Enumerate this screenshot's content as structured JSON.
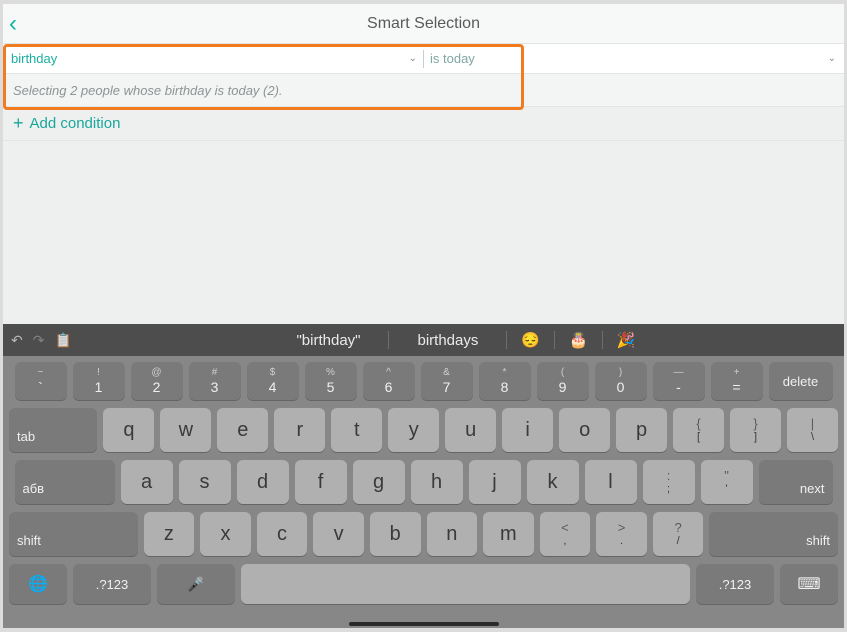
{
  "header": {
    "title": "Smart Selection"
  },
  "condition": {
    "field": "birthday",
    "operator": "is today",
    "summary": "Selecting 2 people whose birthday is today (2)."
  },
  "addCondition": "Add condition",
  "keyboard": {
    "suggestions": [
      "\"birthday\"",
      "birthdays"
    ],
    "emoji": [
      "😔",
      "🎂",
      "🎉"
    ],
    "row1": [
      {
        "t": "~",
        "b": "`"
      },
      {
        "t": "!",
        "b": "1"
      },
      {
        "t": "@",
        "b": "2"
      },
      {
        "t": "#",
        "b": "3"
      },
      {
        "t": "$",
        "b": "4"
      },
      {
        "t": "%",
        "b": "5"
      },
      {
        "t": "^",
        "b": "6"
      },
      {
        "t": "&",
        "b": "7"
      },
      {
        "t": "*",
        "b": "8"
      },
      {
        "t": "(",
        "b": "9"
      },
      {
        "t": ")",
        "b": "0"
      },
      {
        "t": "—",
        "b": "-"
      },
      {
        "t": "+",
        "b": "="
      }
    ],
    "delete": "delete",
    "tab": "tab",
    "row2": [
      "q",
      "w",
      "e",
      "r",
      "t",
      "y",
      "u",
      "i",
      "o",
      "p"
    ],
    "row2p": [
      {
        "t": "{",
        "b": "["
      },
      {
        "t": "}",
        "b": "]"
      },
      {
        "t": "|",
        "b": "\\"
      }
    ],
    "langKey": "абв",
    "row3": [
      "a",
      "s",
      "d",
      "f",
      "g",
      "h",
      "j",
      "k",
      "l"
    ],
    "row3p": [
      {
        "t": ":",
        "b": ";"
      },
      {
        "t": "\"",
        "b": "'"
      }
    ],
    "next": "next",
    "shift": "shift",
    "row4": [
      "z",
      "x",
      "c",
      "v",
      "b",
      "n",
      "m"
    ],
    "row4p": [
      {
        "t": "<",
        "b": ","
      },
      {
        "t": ">",
        "b": "."
      },
      {
        "t": "?",
        "b": "/"
      }
    ],
    "mode": ".?123"
  }
}
